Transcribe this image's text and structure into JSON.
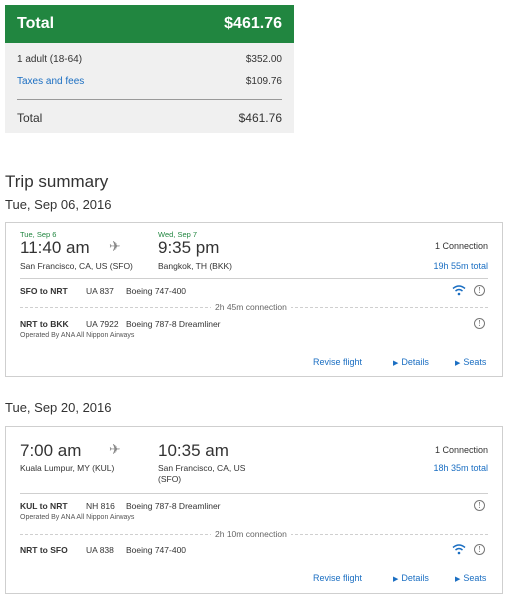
{
  "price": {
    "header_label": "Total",
    "header_amount": "$461.76",
    "rows": [
      {
        "label": "1 adult (18-64)",
        "amount": "$352.00"
      },
      {
        "label": "Taxes and fees",
        "amount": "$109.76"
      }
    ],
    "total_label": "Total",
    "total_amount": "$461.76"
  },
  "trip": {
    "title": "Trip summary",
    "legs": [
      {
        "date": "Tue, Sep 06, 2016",
        "depart_date": "Tue, Sep 6",
        "depart_time": "11:40 am",
        "depart_city": "San Francisco, CA, US (SFO)",
        "arrive_date": "Wed, Sep 7",
        "arrive_time": "9:35 pm",
        "arrive_city": "Bangkok, TH (BKK)",
        "connections": "1 Connection",
        "duration": "19h 55m total",
        "segments": [
          {
            "route": "SFO to NRT",
            "flight": "UA 837",
            "aircraft": "Boeing 747-400",
            "operated": ""
          },
          {
            "route": "NRT to BKK",
            "flight": "UA 7922",
            "aircraft": "Boeing 787-8 Dreamliner",
            "operated": "Operated By ANA All Nippon Airways"
          }
        ],
        "connection_time": "2h 45m connection"
      },
      {
        "date": "Tue, Sep 20, 2016",
        "depart_time": "7:00 am",
        "depart_city": "Kuala Lumpur, MY (KUL)",
        "arrive_time": "10:35 am",
        "arrive_city_line1": "San Francisco, CA, US",
        "arrive_city_line2": "(SFO)",
        "connections": "1 Connection",
        "duration": "18h 35m total",
        "segments": [
          {
            "route": "KUL to NRT",
            "flight": "NH 816",
            "aircraft": "Boeing 787-8 Dreamliner",
            "operated": "Operated By ANA All Nippon Airways"
          },
          {
            "route": "NRT to SFO",
            "flight": "UA 838",
            "aircraft": "Boeing 747-400",
            "operated": ""
          }
        ],
        "connection_time": "2h 10m connection"
      }
    ],
    "actions": {
      "revise": "Revise flight",
      "details": "Details",
      "seats": "Seats"
    }
  },
  "icons": {
    "plane": "airplane-icon",
    "wifi": "wifi-icon",
    "info": "info-icon",
    "triangle": "triangle-right-icon"
  },
  "colors": {
    "brand_green": "#218640",
    "link_blue": "#1a6ec2"
  }
}
